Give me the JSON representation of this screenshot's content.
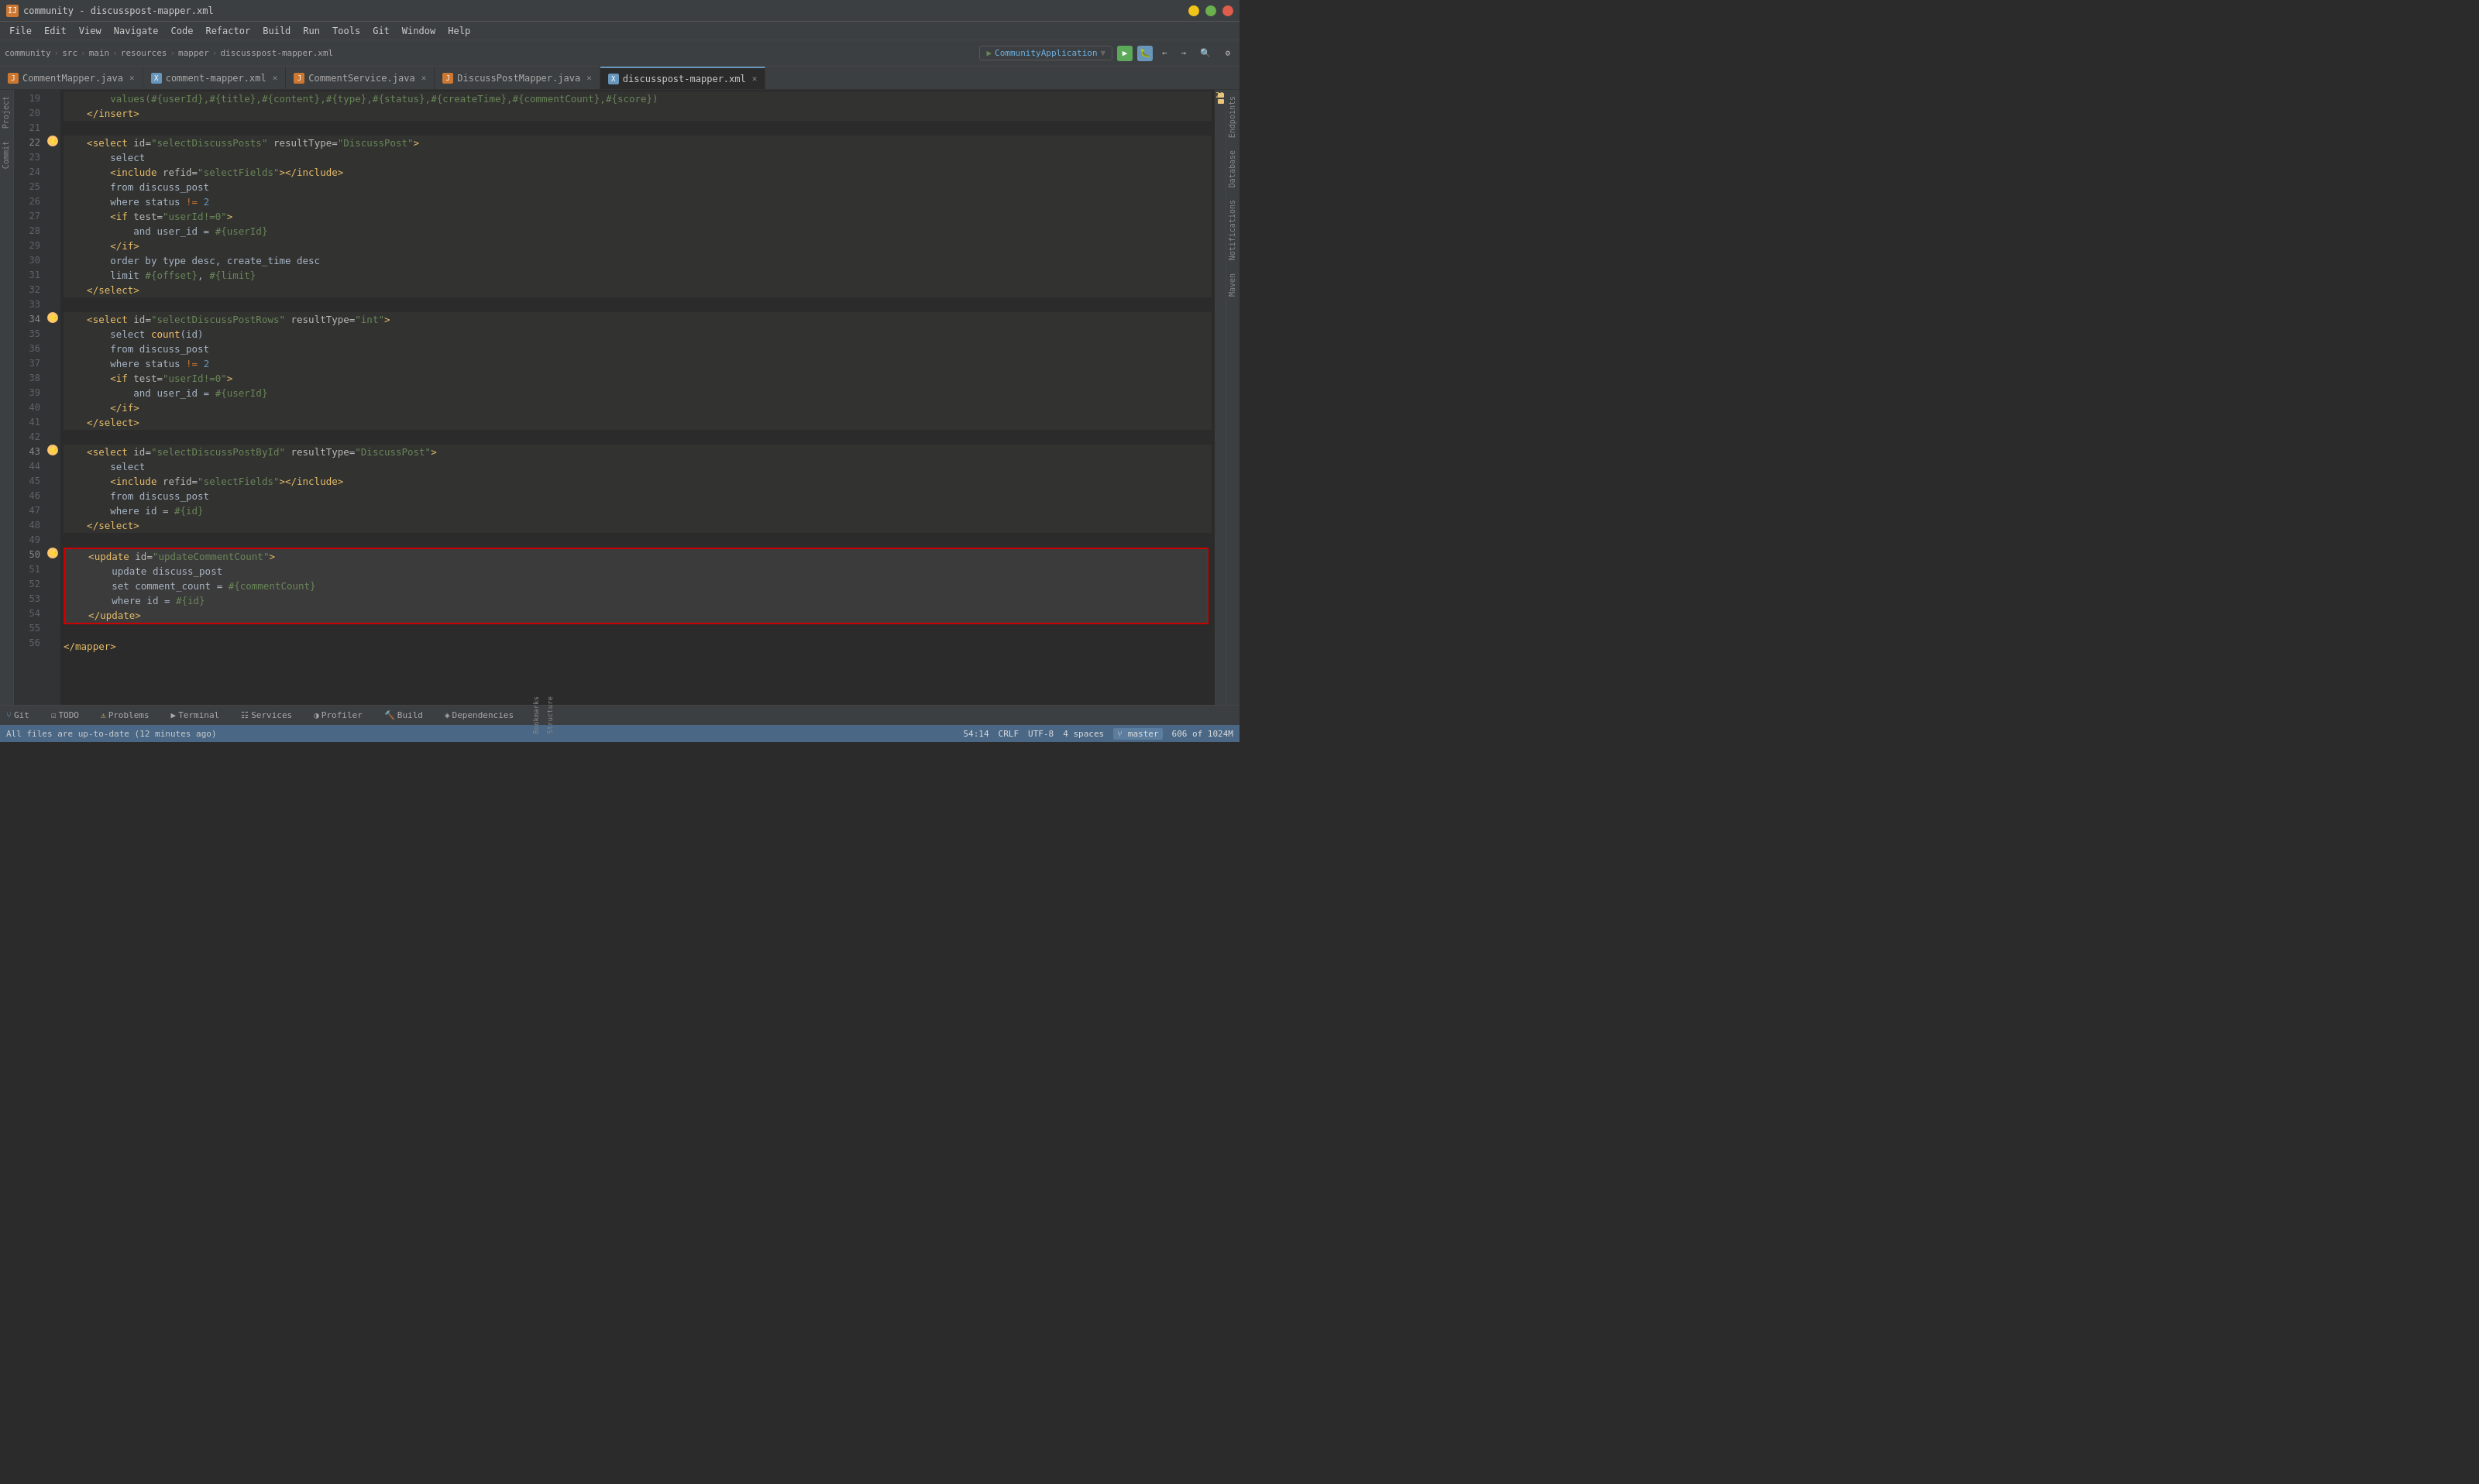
{
  "titlebar": {
    "title": "community - discusspost-mapper.xml",
    "app_icon": "IJ"
  },
  "menubar": {
    "items": [
      "File",
      "Edit",
      "View",
      "Navigate",
      "Code",
      "Refactor",
      "Build",
      "Run",
      "Tools",
      "Git",
      "Window",
      "Help"
    ]
  },
  "breadcrumb": {
    "parts": [
      "community",
      "src",
      "main",
      "resources",
      "mapper",
      "discusspost-mapper.xml"
    ]
  },
  "run_config": "CommunityApplication",
  "tabs": [
    {
      "id": "comment-mapper",
      "label": "CommentMapper.java",
      "type": "java",
      "active": false,
      "modified": false
    },
    {
      "id": "comment-mapper-xml",
      "label": "comment-mapper.xml",
      "type": "xml",
      "active": false,
      "modified": false
    },
    {
      "id": "comment-service",
      "label": "CommentService.java",
      "type": "java",
      "active": false,
      "modified": false
    },
    {
      "id": "discusspost-mapper",
      "label": "DiscussPostMapper.java",
      "type": "java",
      "active": false,
      "modified": false
    },
    {
      "id": "discusspost-mapper-xml",
      "label": "discusspost-mapper.xml",
      "type": "xml",
      "active": true,
      "modified": false
    }
  ],
  "lines": [
    {
      "num": 19,
      "content": "        values(#{userId},#{title},#{content},#{type},#{status},#{createTime},#{commentCount},#{score})"
    },
    {
      "num": 20,
      "content": "    </insert>"
    },
    {
      "num": 21,
      "content": ""
    },
    {
      "num": 22,
      "content": "    <select id=\"selectDiscussPosts\" resultType=\"DiscussPost\">"
    },
    {
      "num": 23,
      "content": "        select"
    },
    {
      "num": 24,
      "content": "        <include refid=\"selectFields\"></include>"
    },
    {
      "num": 25,
      "content": "        from discuss_post"
    },
    {
      "num": 26,
      "content": "        where status != 2"
    },
    {
      "num": 27,
      "content": "        <if test=\"userId!=0\">"
    },
    {
      "num": 28,
      "content": "            and user_id = #{userId}"
    },
    {
      "num": 29,
      "content": "        </if>"
    },
    {
      "num": 30,
      "content": "        order by type desc, create_time desc"
    },
    {
      "num": 31,
      "content": "        limit #{offset}, #{limit}"
    },
    {
      "num": 32,
      "content": "    </select>"
    },
    {
      "num": 33,
      "content": ""
    },
    {
      "num": 34,
      "content": "    <select id=\"selectDiscussPostRows\" resultType=\"int\">"
    },
    {
      "num": 35,
      "content": "        select count(id)"
    },
    {
      "num": 36,
      "content": "        from discuss_post"
    },
    {
      "num": 37,
      "content": "        where status != 2"
    },
    {
      "num": 38,
      "content": "        <if test=\"userId!=0\">"
    },
    {
      "num": 39,
      "content": "            and user_id = #{userId}"
    },
    {
      "num": 40,
      "content": "        </if>"
    },
    {
      "num": 41,
      "content": "    </select>"
    },
    {
      "num": 42,
      "content": ""
    },
    {
      "num": 43,
      "content": "    <select id=\"selectDiscussPostById\" resultType=\"DiscussPost\">"
    },
    {
      "num": 44,
      "content": "        select"
    },
    {
      "num": 45,
      "content": "        <include refid=\"selectFields\"></include>"
    },
    {
      "num": 46,
      "content": "        from discuss_post"
    },
    {
      "num": 47,
      "content": "        where id = #{id}"
    },
    {
      "num": 48,
      "content": "    </select>"
    },
    {
      "num": 49,
      "content": ""
    },
    {
      "num": 50,
      "content": "    <update id=\"updateCommentCount\">",
      "red": true
    },
    {
      "num": 51,
      "content": "        update discuss_post",
      "red": true
    },
    {
      "num": 52,
      "content": "        set comment_count = #{commentCount}",
      "red": true
    },
    {
      "num": 53,
      "content": "        where id = #{id}",
      "red": true
    },
    {
      "num": 54,
      "content": "    </update>",
      "red": true
    },
    {
      "num": 55,
      "content": ""
    },
    {
      "num": 56,
      "content": "</mapper>"
    }
  ],
  "bottom_tabs": [
    {
      "label": "Git",
      "icon": "⑂",
      "active": false
    },
    {
      "label": "TODO",
      "icon": "☑",
      "active": false
    },
    {
      "label": "Problems",
      "icon": "⚠",
      "active": false
    },
    {
      "label": "Terminal",
      "icon": "▶",
      "active": false
    },
    {
      "label": "Services",
      "icon": "☷",
      "active": false
    },
    {
      "label": "Profiler",
      "icon": "◑",
      "active": false
    },
    {
      "label": "Build",
      "icon": "🔨",
      "active": false
    },
    {
      "label": "Dependencies",
      "icon": "◈",
      "active": false
    }
  ],
  "statusbar": {
    "git_branch": "master",
    "line_col": "54:14",
    "encoding": "CRLF",
    "charset": "UTF-8",
    "indent": "4 spaces",
    "loc": "606 of 1024M",
    "notification": "All files are up-to-date (12 minutes ago)",
    "warnings": "29",
    "errors": "1"
  },
  "right_panels": [
    "Endpoints",
    "Database",
    "Notifications",
    "Maven"
  ],
  "left_panels": [
    "Project",
    "Commit",
    "Bookmarks",
    "Structure"
  ]
}
